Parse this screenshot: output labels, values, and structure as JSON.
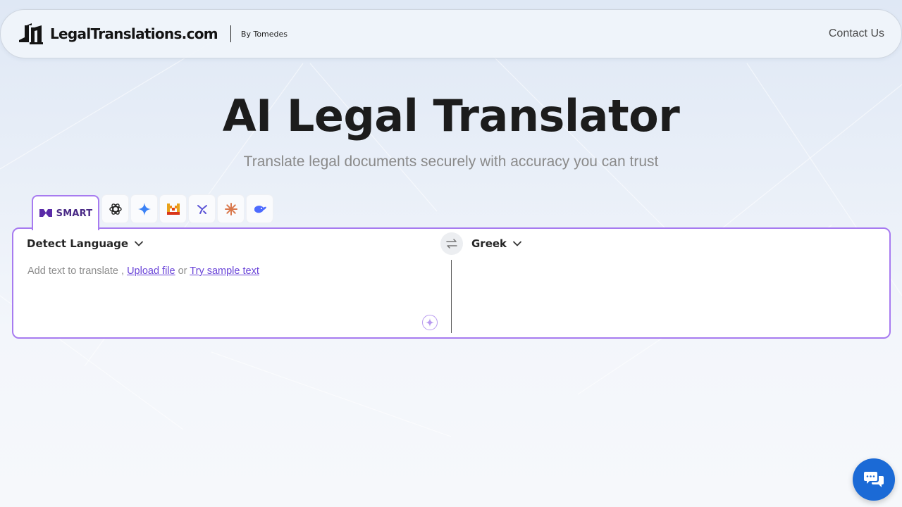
{
  "header": {
    "brand_name": "LegalTranslations.com",
    "brand_by": "By Tomedes",
    "contact_label": "Contact Us"
  },
  "hero": {
    "title": "AI Legal Translator",
    "subtitle": "Translate legal documents securely with accuracy you can trust"
  },
  "model_tabs": {
    "active_label": "SMART",
    "icons": [
      "smart-logo-icon",
      "openai-icon",
      "gemini-sparkle-icon",
      "mistral-icon",
      "perplexity-icon",
      "claude-icon",
      "deepseek-whale-icon"
    ]
  },
  "translator": {
    "source_language": "Detect Language",
    "target_language": "Greek",
    "placeholder_prefix": "Add text to translate ,",
    "upload_link": "Upload file",
    "or_text": "or",
    "sample_link": "Try sample text"
  },
  "colors": {
    "accent": "#a77bf0",
    "link": "#6a44d8",
    "chat_button": "#1b6ad6"
  }
}
